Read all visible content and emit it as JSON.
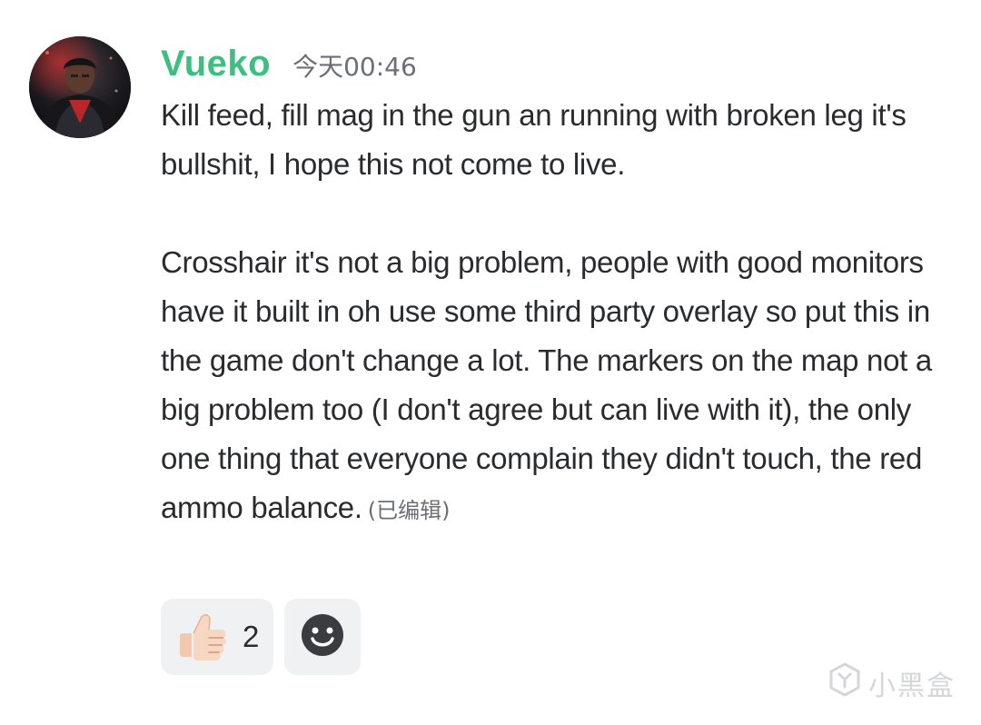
{
  "message": {
    "username": "Vueko",
    "timestamp": "今天00:46",
    "paragraphs": [
      "Kill feed, fill mag in the gun an running with broken leg it's bullshit, I hope this not come to live.",
      "Crosshair it's not a big problem, people with good monitors have it built in oh use some third party overlay so put this in the game don't change a lot. The markers on the map not a big problem too (I don't agree but can live with it), the only one thing that everyone complain they didn't touch, the red ammo balance."
    ],
    "edited_label": "(已编辑)",
    "avatar_icon": "user-avatar"
  },
  "reactions": [
    {
      "icon": "thumbs-up-icon",
      "count": "2"
    }
  ],
  "add_reaction_icon": "smiley-icon",
  "watermark": {
    "text": "小黑盒",
    "icon": "xiaoheihe-logo-icon"
  },
  "colors": {
    "username": "#3fbf7f",
    "text": "#2a2b2e",
    "muted": "#6b6f76",
    "chip_bg": "#f0f1f3"
  }
}
